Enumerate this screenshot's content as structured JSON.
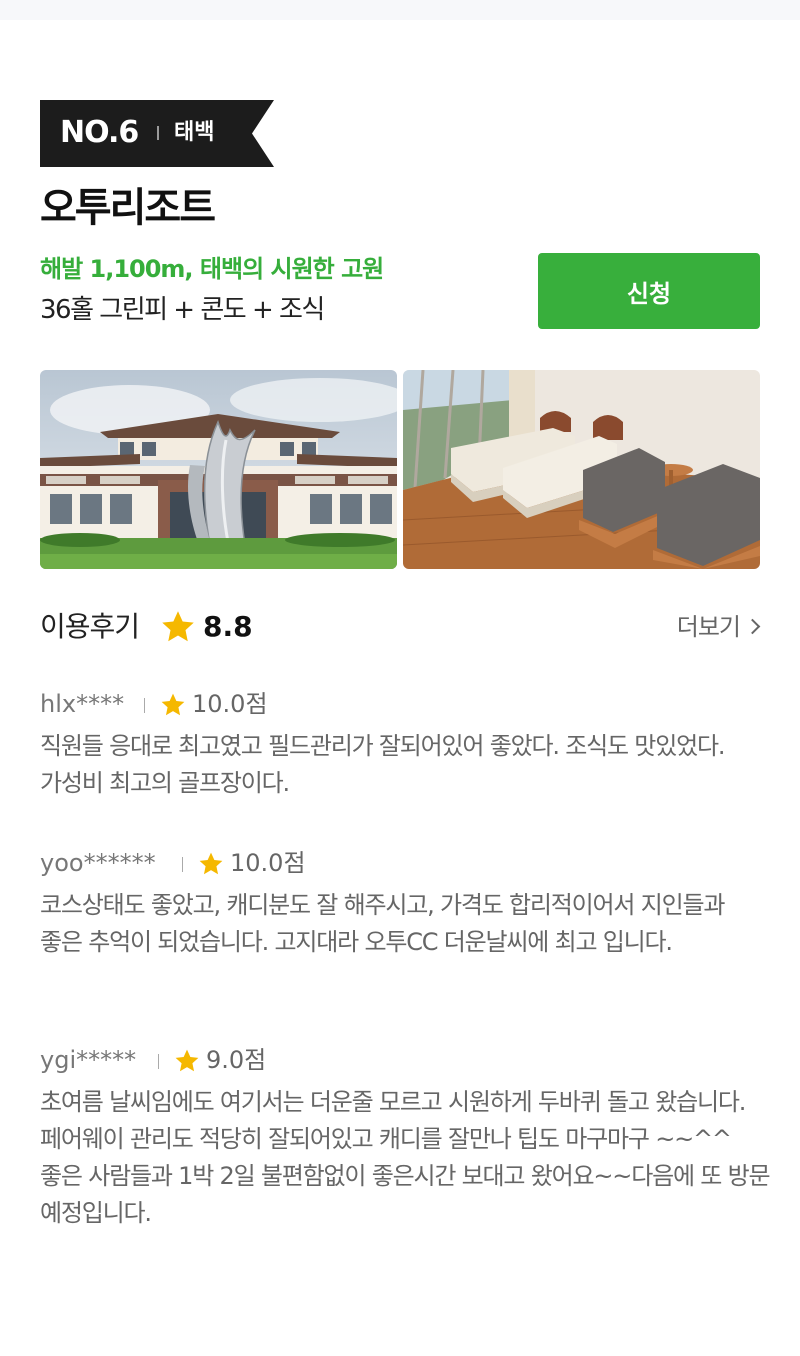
{
  "rank": {
    "label": "NO.6",
    "region": "태백"
  },
  "resort": {
    "name": "오투리조트",
    "tagline": "해발 1,100m, 태백의 시원한 고원",
    "package": "36홀 그린피 + 콘도 + 조식"
  },
  "apply_button": {
    "label": "신청"
  },
  "photos": [
    {
      "alt": "resort-building-photo"
    },
    {
      "alt": "resort-room-photo"
    }
  ],
  "reviews": {
    "title": "이용후기",
    "score": "8.8",
    "more_label": "더보기",
    "items": [
      {
        "user": "hlx****",
        "rating": "10.0점",
        "text": "직원들 응대로 최고였고 필드관리가 잘되어있어 좋았다. 조식도 맛있었다. 가성비 최고의 골프장이다."
      },
      {
        "user": "yoo******",
        "rating": "10.0점",
        "text": "코스상태도 좋았고, 캐디분도 잘 해주시고, 가격도 합리적이어서 지인들과 좋은 추억이 되었습니다. 고지대라 오투CC 더운날씨에 최고 입니다."
      },
      {
        "user": "ygi*****",
        "rating": "9.0점",
        "text": "초여름 날씨임에도 여기서는 더운줄 모르고 시원하게 두바퀴 돌고 왔습니다.페어웨이 관리도 적당히 잘되어있고 캐디를 잘만나 팁도 마구마구 ~~^^\n좋은 사람들과 1박 2일 불편함없이 좋은시간 보대고 왔어요~~다음에 또 방문 예정입니다."
      }
    ]
  },
  "colors": {
    "accent_green": "#38af3c",
    "ribbon_black": "#1c1c1c",
    "star_yellow": "#f5b800"
  }
}
